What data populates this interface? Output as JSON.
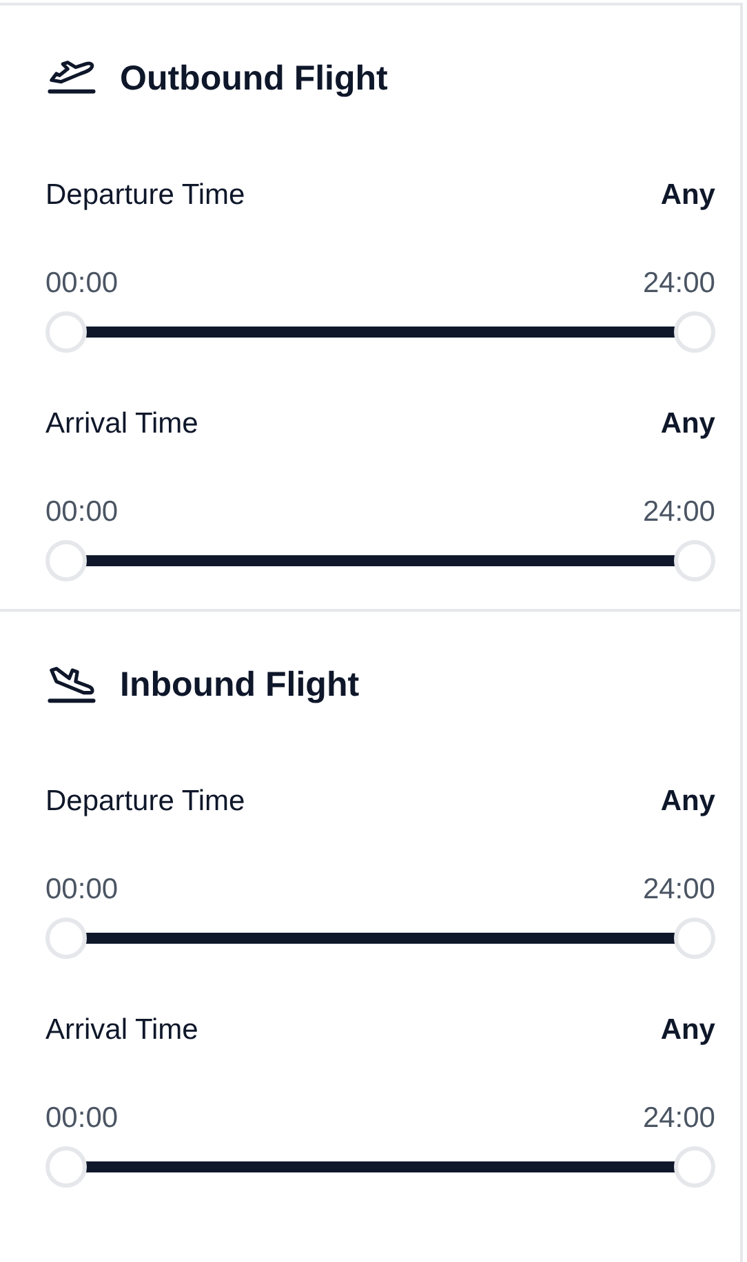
{
  "sections": [
    {
      "title": "Outbound Flight",
      "filters": [
        {
          "label": "Departure Time",
          "value": "Any",
          "min_label": "00:00",
          "max_label": "24:00",
          "thumbs": [
            {
              "level": 0
            },
            {
              "level": 1
            }
          ]
        },
        {
          "label": "Arrival Time",
          "value": "Any",
          "min_label": "00:00",
          "max_label": "24:00",
          "thumbs": [
            {
              "level": 0
            },
            {
              "level": 1
            }
          ]
        }
      ]
    },
    {
      "title": "Inbound Flight",
      "filters": [
        {
          "label": "Departure Time",
          "value": "Any",
          "min_label": "00:00",
          "max_label": "24:00",
          "thumbs": [
            {
              "level": 0
            },
            {
              "level": 1
            }
          ]
        },
        {
          "label": "Arrival Time",
          "value": "Any",
          "min_label": "00:00",
          "max_label": "24:00",
          "thumbs": [
            {
              "level": 0
            },
            {
              "level": 1
            }
          ]
        }
      ]
    }
  ]
}
